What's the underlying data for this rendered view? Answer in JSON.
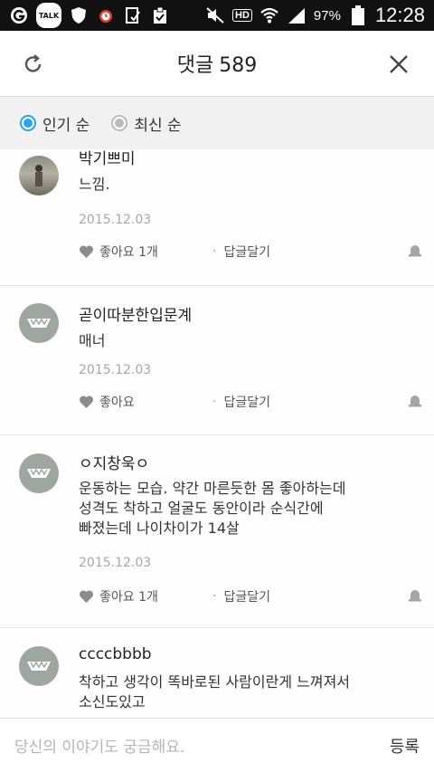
{
  "status_bar": {
    "talk_label": "TALK",
    "hd_label": "HD",
    "battery": "97%",
    "time": "12:28"
  },
  "header": {
    "title": "댓글",
    "count": "589"
  },
  "sort": {
    "popular": "인기 순",
    "latest": "최신 순"
  },
  "comments": [
    {
      "author": "박기쁘미",
      "text": "느낌.",
      "date": "2015.12.03",
      "like": "좋아요 1개",
      "reply": "답글달기"
    },
    {
      "author": "곧이따분한입문계",
      "text": "매너",
      "date": "2015.12.03",
      "like": "좋아요",
      "reply": "답글달기"
    },
    {
      "author": "ㅇ지창욱ㅇ",
      "text": "운동하는 모습. 약간 마른듯한 몸 좋아하는데\n성격도 착하고 얼굴도 동안이라 순식간에\n빠졌는데 나이차이가 14살",
      "date": "2015.12.03",
      "like": "좋아요 1개",
      "reply": "답글달기"
    },
    {
      "author": "ccccbbbb",
      "text": "착하고 생각이 똑바로된 사람이란게 느껴져서\n소신도있고"
    }
  ],
  "composer": {
    "placeholder": "당신의 이야기도 궁금해요.",
    "submit": "등록"
  }
}
